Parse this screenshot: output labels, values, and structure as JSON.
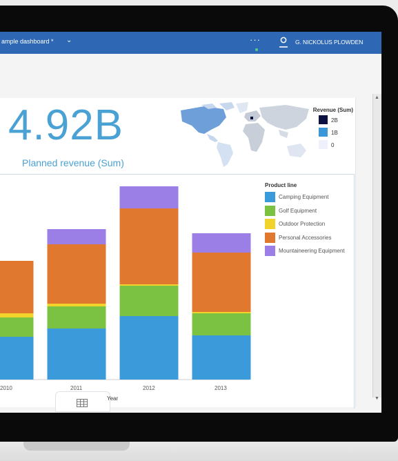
{
  "topbar": {
    "dashboard_title": "ample dashboard *",
    "more_label": "···",
    "user_name": "G. NICKOLUS PLOWDEN"
  },
  "kpi": {
    "value": "4.92B",
    "label": "Planned revenue (Sum)",
    "color": "#4aa1d4"
  },
  "revenue_legend": {
    "title": "Revenue (Sum)",
    "items": [
      {
        "label": "2B",
        "color": "#0b1140"
      },
      {
        "label": "1B",
        "color": "#3a98d8"
      },
      {
        "label": "0",
        "color": "#eef1fb"
      }
    ]
  },
  "product_legend": {
    "title": "Product line",
    "items": [
      {
        "label": "Camping Equipment",
        "color": "#3b9ad9"
      },
      {
        "label": "Golf Equipment",
        "color": "#7cc242"
      },
      {
        "label": "Outdoor Protection",
        "color": "#f2d32c"
      },
      {
        "label": "Personal Accessories",
        "color": "#e0782f"
      },
      {
        "label": "Mountaineering Equipment",
        "color": "#9b7ee6"
      }
    ]
  },
  "chart_data": {
    "type": "bar",
    "stacked": true,
    "categories": [
      "2010",
      "2011",
      "2012",
      "2013"
    ],
    "xlabel": "Year",
    "ylabel": "",
    "ylim": [
      0,
      1.4
    ],
    "grid": false,
    "legend": "right",
    "series": [
      {
        "name": "Camping Equipment",
        "color": "#3b9ad9",
        "values": [
          0.31,
          0.37,
          0.46,
          0.32
        ]
      },
      {
        "name": "Golf Equipment",
        "color": "#7cc242",
        "values": [
          0.14,
          0.16,
          0.22,
          0.16
        ]
      },
      {
        "name": "Outdoor Protection",
        "color": "#f2d32c",
        "values": [
          0.03,
          0.02,
          0.01,
          0.01
        ]
      },
      {
        "name": "Personal Accessories",
        "color": "#e0782f",
        "values": [
          0.38,
          0.43,
          0.55,
          0.43
        ]
      },
      {
        "name": "Mountaineering Equipment",
        "color": "#9b7ee6",
        "values": [
          0.0,
          0.11,
          0.16,
          0.14
        ]
      }
    ]
  }
}
